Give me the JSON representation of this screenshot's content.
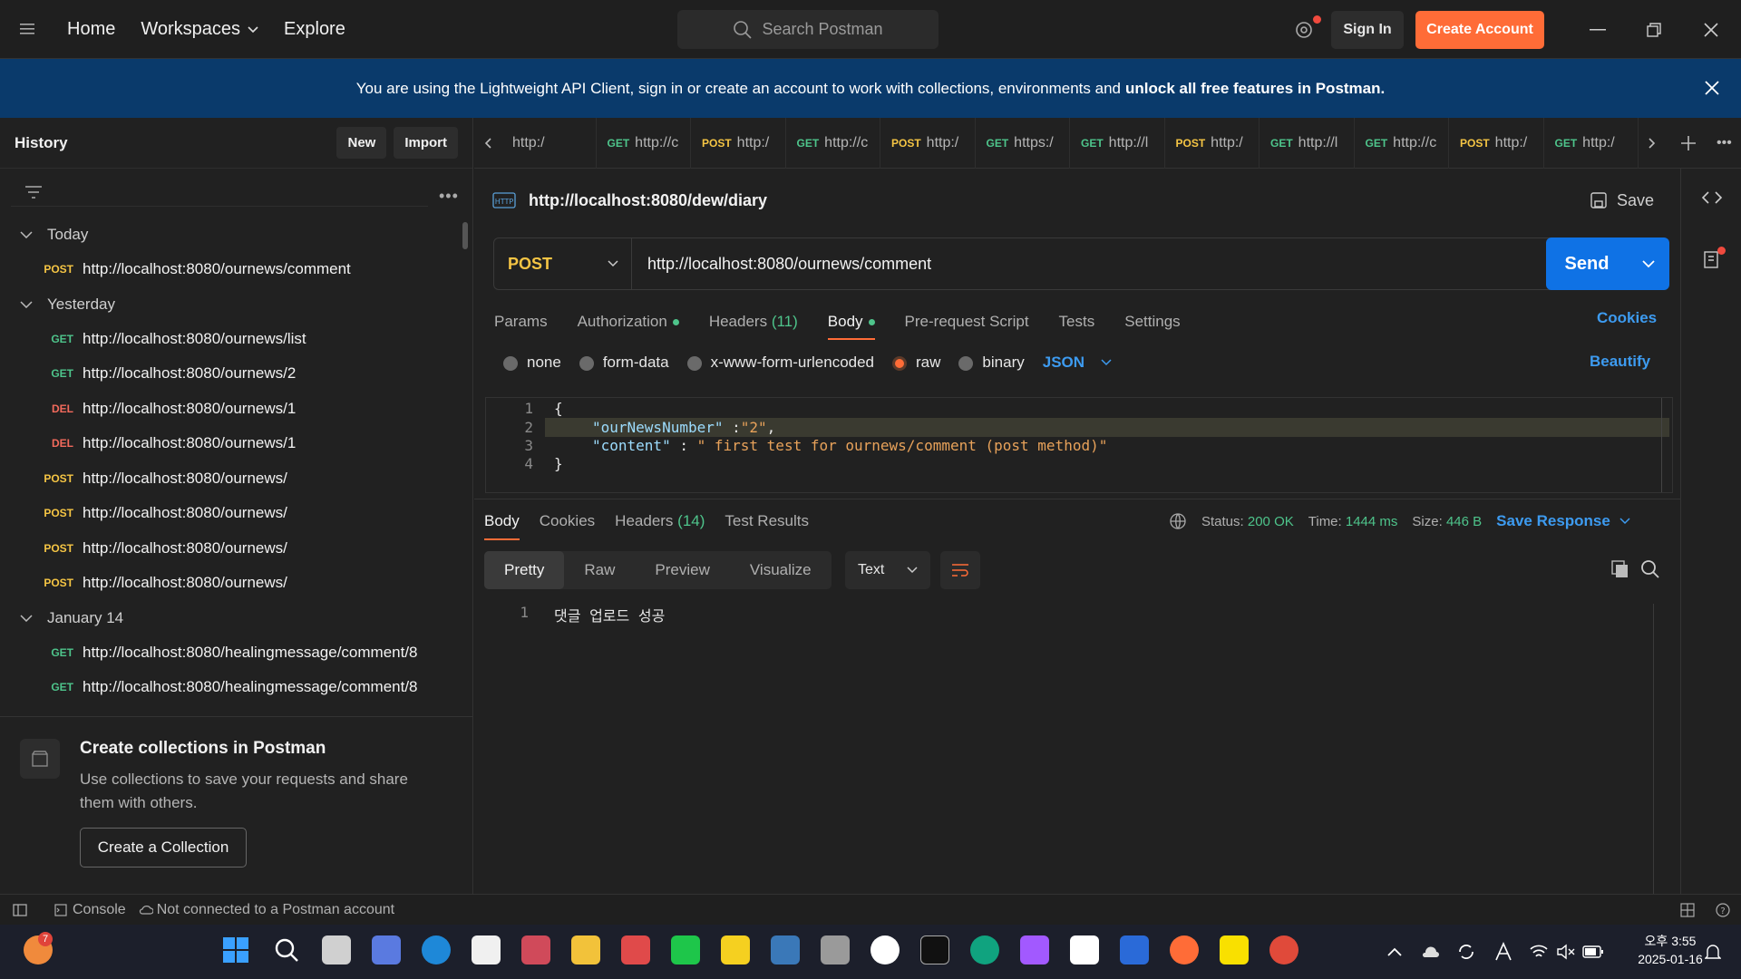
{
  "topbar": {
    "nav": [
      "Home",
      "Workspaces",
      "Explore"
    ],
    "search_placeholder": "Search Postman",
    "sign_in": "Sign In",
    "create_account": "Create Account"
  },
  "banner": {
    "text": "You are using the Lightweight API Client, sign in or create an account to work with collections, environments and",
    "bold": "unlock all free features in Postman."
  },
  "sidebar": {
    "title": "History",
    "new_label": "New",
    "import_label": "Import",
    "groups": [
      {
        "label": "Today",
        "items": [
          {
            "method": "POST",
            "url": "http://localhost:8080/ournews/comment"
          }
        ]
      },
      {
        "label": "Yesterday",
        "items": [
          {
            "method": "GET",
            "url": "http://localhost:8080/ournews/list"
          },
          {
            "method": "GET",
            "url": "http://localhost:8080/ournews/2"
          },
          {
            "method": "DEL",
            "url": "http://localhost:8080/ournews/1"
          },
          {
            "method": "DEL",
            "url": "http://localhost:8080/ournews/1"
          },
          {
            "method": "POST",
            "url": "http://localhost:8080/ournews/"
          },
          {
            "method": "POST",
            "url": "http://localhost:8080/ournews/"
          },
          {
            "method": "POST",
            "url": "http://localhost:8080/ournews/"
          },
          {
            "method": "POST",
            "url": "http://localhost:8080/ournews/"
          }
        ]
      },
      {
        "label": "January 14",
        "items": [
          {
            "method": "GET",
            "url": "http://localhost:8080/healingmessage/comment/8"
          },
          {
            "method": "GET",
            "url": "http://localhost:8080/healingmessage/comment/8"
          }
        ]
      }
    ],
    "collections_title": "Create collections in Postman",
    "collections_desc": "Use collections to save your requests and share them with others.",
    "create_collection": "Create a Collection"
  },
  "tabs": [
    {
      "method": "",
      "url": "http:/"
    },
    {
      "method": "GET",
      "url": "http://c"
    },
    {
      "method": "POST",
      "url": "http:/"
    },
    {
      "method": "GET",
      "url": "http://c"
    },
    {
      "method": "POST",
      "url": "http:/"
    },
    {
      "method": "GET",
      "url": "https:/"
    },
    {
      "method": "GET",
      "url": "http://l"
    },
    {
      "method": "POST",
      "url": "http:/"
    },
    {
      "method": "GET",
      "url": "http://l"
    },
    {
      "method": "GET",
      "url": "http://c"
    },
    {
      "method": "POST",
      "url": "http:/"
    },
    {
      "method": "GET",
      "url": "http:/"
    }
  ],
  "request": {
    "name": "http://localhost:8080/dew/diary",
    "save_label": "Save",
    "method": "POST",
    "url": "http://localhost:8080/ournews/comment",
    "send_label": "Send",
    "tabs": {
      "params": "Params",
      "authorization": "Authorization",
      "headers": "Headers",
      "headers_count": "(11)",
      "body": "Body",
      "prerequest": "Pre-request Script",
      "tests": "Tests",
      "settings": "Settings"
    },
    "cookies": "Cookies",
    "body_types": [
      "none",
      "form-data",
      "x-www-form-urlencoded",
      "raw",
      "binary"
    ],
    "body_type_selected": "raw",
    "format": "JSON",
    "beautify": "Beautify",
    "code_lines": [
      "{",
      "\"ourNewsNumber\" :\"2\",",
      "\"content\" : \" first test for ournews/comment (post method)\"",
      "}"
    ],
    "code_key1": "\"ourNewsNumber\"",
    "code_sep1": " :",
    "code_val1": "\"2\"",
    "code_key2": "\"content\"",
    "code_sep2": " : ",
    "code_val2": "\" first test for ournews/comment (post method)\""
  },
  "response": {
    "tabs": {
      "body": "Body",
      "cookies": "Cookies",
      "headers": "Headers",
      "headers_count": "(14)",
      "test_results": "Test Results"
    },
    "status_label": "Status:",
    "status": "200 OK",
    "time_label": "Time:",
    "time": "1444 ms",
    "size_label": "Size:",
    "size": "446 B",
    "save_response": "Save Response",
    "view_tabs": [
      "Pretty",
      "Raw",
      "Preview",
      "Visualize"
    ],
    "format": "Text",
    "line1": "댓글 업로드 성공"
  },
  "statusbar": {
    "console": "Console",
    "connection": "Not connected to a Postman account"
  },
  "taskbar": {
    "time": "오후 3:55",
    "date": "2025-01-16",
    "notif_count": "7"
  },
  "colors": {
    "accent": "#ff6c37",
    "link": "#3d9bf0",
    "post": "#f5c544",
    "get": "#4ec48b",
    "delete": "#f26a5c",
    "banner": "#0a3a6b"
  }
}
